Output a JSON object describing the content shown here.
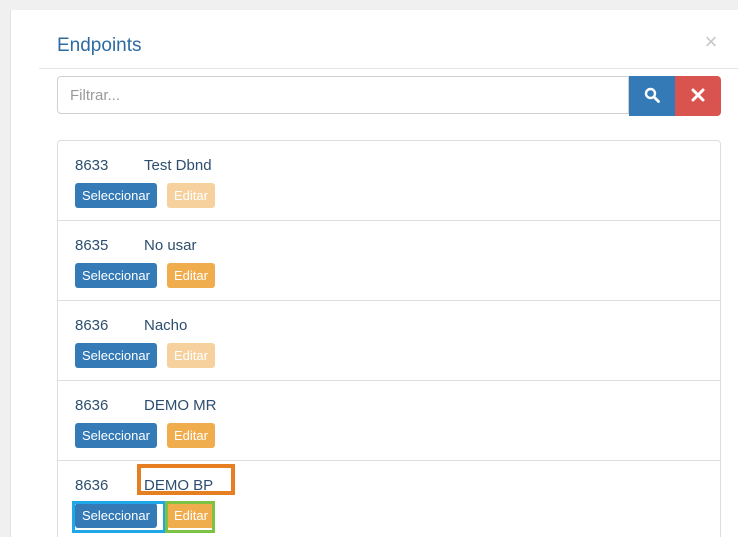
{
  "modal": {
    "title": "Endpoints",
    "close_label": "×"
  },
  "filter": {
    "placeholder": "Filtrar...",
    "value": ""
  },
  "icons": {
    "search": "search-icon",
    "clear": "times-icon"
  },
  "colors": {
    "primary": "#337ab7",
    "warning": "#f0ad4e",
    "danger": "#d9534f",
    "highlight_name": "#e67e22",
    "highlight_select": "#1fa7e8",
    "highlight_edit": "#7dc242"
  },
  "items": [
    {
      "id": "8633",
      "name": "Test Dbnd",
      "select_label": "Seleccionar",
      "edit_label": "Editar",
      "edit_disabled": true
    },
    {
      "id": "8635",
      "name": "No usar",
      "select_label": "Seleccionar",
      "edit_label": "Editar",
      "edit_disabled": false
    },
    {
      "id": "8636",
      "name": "Nacho",
      "select_label": "Seleccionar",
      "edit_label": "Editar",
      "edit_disabled": true
    },
    {
      "id": "8636",
      "name": "DEMO MR",
      "select_label": "Seleccionar",
      "edit_label": "Editar",
      "edit_disabled": false
    },
    {
      "id": "8636",
      "name": "DEMO BP",
      "select_label": "Seleccionar",
      "edit_label": "Editar",
      "edit_disabled": false
    }
  ]
}
